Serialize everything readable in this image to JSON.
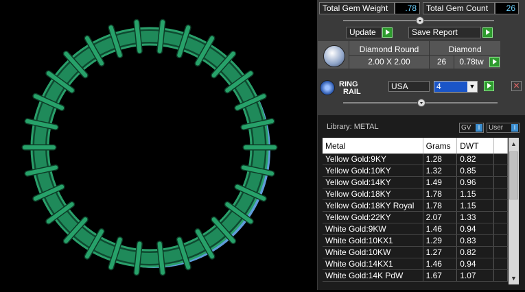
{
  "summary": {
    "weight_label": "Total Gem Weight",
    "weight_value": ".78",
    "count_label": "Total Gem Count",
    "count_value": "26"
  },
  "actions": {
    "update_label": "Update",
    "save_report_label": "Save Report"
  },
  "gem": {
    "shape": "Diamond Round",
    "type": "Diamond",
    "size": "2.00 X 2.00",
    "count": "26",
    "tw": "0.78tw"
  },
  "rail": {
    "title_line1": "RING",
    "title_line2": "RAIL",
    "country": "USA",
    "size_value": "4"
  },
  "library": {
    "label": "Library: METAL",
    "gv_label": "GV",
    "user_label": "User",
    "columns": [
      "Metal",
      "Grams",
      "DWT"
    ],
    "rows": [
      [
        "Yellow Gold:9KY",
        "1.28",
        "0.82"
      ],
      [
        "Yellow Gold:10KY",
        "1.32",
        "0.85"
      ],
      [
        "Yellow Gold:14KY",
        "1.49",
        "0.96"
      ],
      [
        "Yellow Gold:18KY",
        "1.78",
        "1.15"
      ],
      [
        "Yellow Gold:18KY Royal",
        "1.78",
        "1.15"
      ],
      [
        "Yellow Gold:22KY",
        "2.07",
        "1.33"
      ],
      [
        "White Gold:9KW",
        "1.46",
        "0.94"
      ],
      [
        "White Gold:10KX1",
        "1.29",
        "0.83"
      ],
      [
        "White Gold:10KW",
        "1.27",
        "0.82"
      ],
      [
        "White Gold:14KX1",
        "1.46",
        "0.94"
      ],
      [
        "White Gold:14K PdW",
        "1.67",
        "1.07"
      ]
    ]
  },
  "colors": {
    "ring_green": "#1f8a5a",
    "gem_blue": "#6fb6ff",
    "accent_green": "#2e9b2e"
  }
}
